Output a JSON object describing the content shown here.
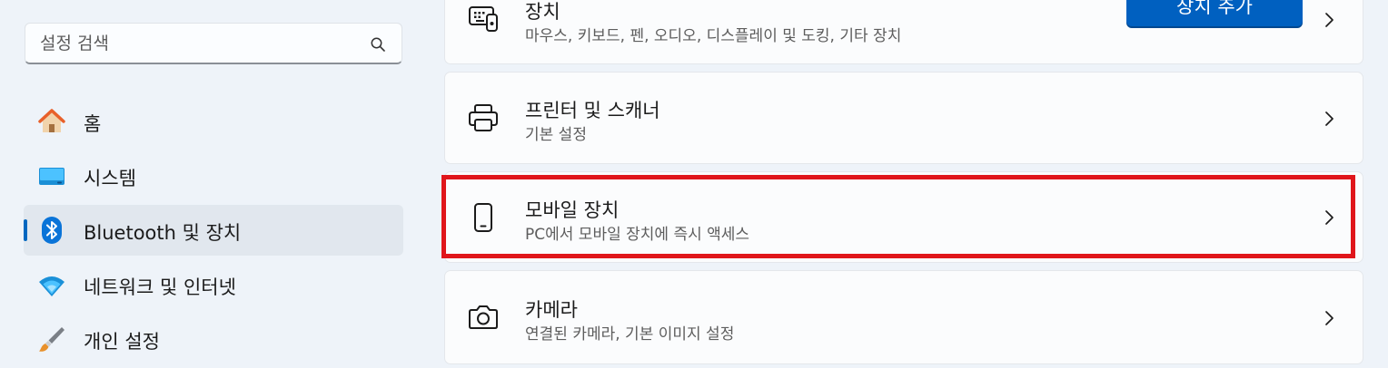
{
  "search": {
    "placeholder": "설정 검색"
  },
  "sidebar": {
    "items": [
      {
        "label": "홈",
        "icon": "home-icon",
        "selected": false
      },
      {
        "label": "시스템",
        "icon": "system-icon",
        "selected": false
      },
      {
        "label": "Bluetooth 및 장치",
        "icon": "bluetooth-icon",
        "selected": true
      },
      {
        "label": "네트워크 및 인터넷",
        "icon": "wifi-icon",
        "selected": false
      },
      {
        "label": "개인 설정",
        "icon": "brush-icon",
        "selected": false
      }
    ]
  },
  "cards": [
    {
      "title": "장치",
      "subtitle": "마우스, 키보드, 펜, 오디오, 디스플레이 및 도킹, 기타 장치",
      "icon": "devices-icon",
      "button": "장치 추가"
    },
    {
      "title": "프린터 및 스캐너",
      "subtitle": "기본 설정",
      "icon": "printer-icon"
    },
    {
      "title": "모바일 장치",
      "subtitle": "PC에서 모바일 장치에 즉시 액세스",
      "icon": "phone-icon",
      "highlighted": true
    },
    {
      "title": "카메라",
      "subtitle": "연결된 카메라, 기본 이미지 설정",
      "icon": "camera-icon"
    }
  ],
  "colors": {
    "accent": "#0067c0",
    "highlight": "#e0161b",
    "background": "#eef3f9"
  }
}
